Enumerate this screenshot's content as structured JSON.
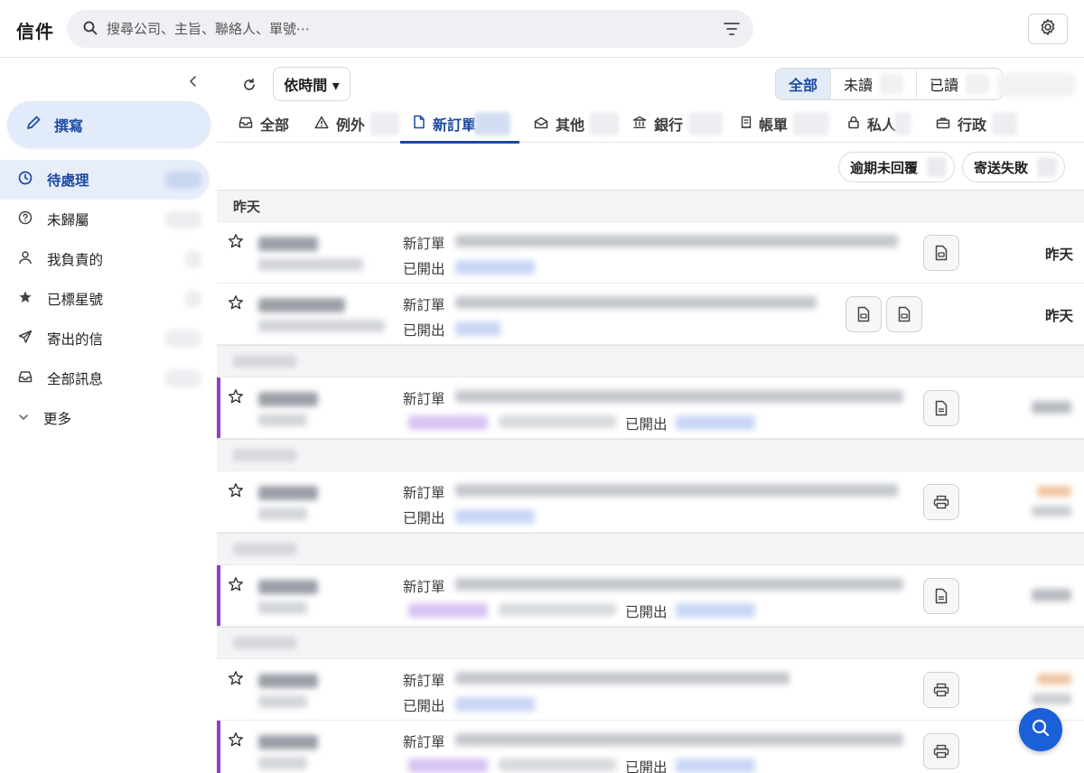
{
  "header": {
    "title": "信件",
    "search_placeholder": "搜尋公司、主旨、聯絡人、單號⋯"
  },
  "sidebar": {
    "compose_label": "撰寫",
    "items": [
      {
        "label": "待處理",
        "icon": "clock-icon",
        "active": true
      },
      {
        "label": "未歸屬",
        "icon": "question-icon"
      },
      {
        "label": "我負責的",
        "icon": "person-icon"
      },
      {
        "label": "已標星號",
        "icon": "star-icon"
      },
      {
        "label": "寄出的信",
        "icon": "send-icon"
      },
      {
        "label": "全部訊息",
        "icon": "inbox-icon"
      }
    ],
    "more_label": "更多"
  },
  "toolbar": {
    "sort_label": "依時間 ▾",
    "read_filter": [
      "全部",
      "未讀",
      "已讀"
    ]
  },
  "category_tabs": [
    {
      "label": "全部",
      "icon": "inbox-icon"
    },
    {
      "label": "例外",
      "icon": "warning-icon"
    },
    {
      "label": "新訂單",
      "icon": "document-icon",
      "active": true
    },
    {
      "label": "其他",
      "icon": "envelope-open-icon"
    },
    {
      "label": "銀行",
      "icon": "bank-icon"
    },
    {
      "label": "帳單",
      "icon": "receipt-icon"
    },
    {
      "label": "私人",
      "icon": "lock-icon"
    },
    {
      "label": "行政",
      "icon": "briefcase-icon"
    }
  ],
  "chips": [
    "逾期未回覆",
    "寄送失敗"
  ],
  "list": {
    "group_yesterday": "昨天",
    "type_label": "新訂單",
    "status_label": "已開出",
    "date_yesterday": "昨天"
  },
  "colors": {
    "accent": "#1d4aa3",
    "flag": "#8c3fc8",
    "fab": "#1b5fd9"
  }
}
